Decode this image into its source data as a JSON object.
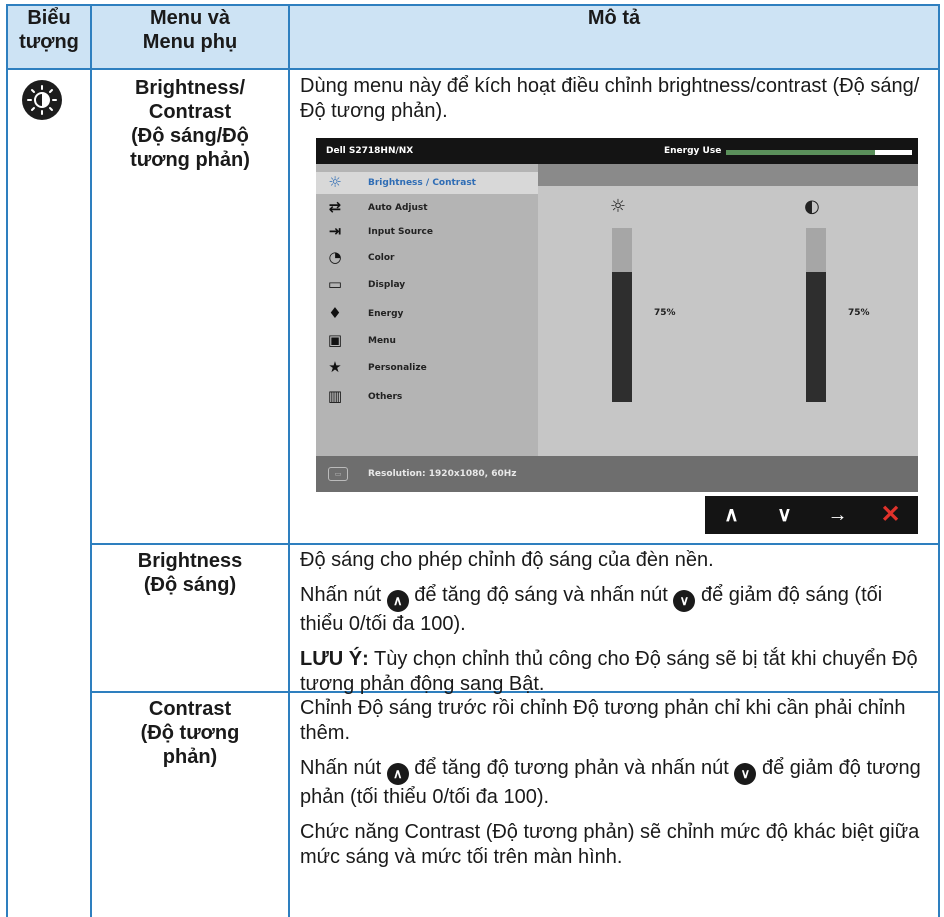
{
  "header": {
    "col1": [
      "Biểu",
      "tượng"
    ],
    "col2": [
      "Menu và",
      "Menu phụ"
    ],
    "col3": "Mô tả"
  },
  "rows": [
    {
      "name": [
        "Brightness/",
        "Contrast",
        "(Độ sáng/Độ",
        "tương phản)"
      ],
      "desc": "Dùng menu này để kích hoạt điều chỉnh brightness/contrast (Độ sáng/Độ tương phản)."
    },
    {
      "name": [
        "Brightness",
        "(Độ sáng)"
      ],
      "p1": "Độ sáng cho phép chỉnh độ sáng của đèn nền.",
      "p2a": "Nhấn nút",
      "p2b": "để tăng độ sáng và nhấn nút",
      "p2c": "để giảm độ sáng (tối thiểu 0/tối đa 100).",
      "note_label": "LƯU Ý:",
      "note_text": "Tùy chọn chỉnh thủ công cho Độ sáng sẽ bị tắt khi chuyển Độ tương phản động sang Bật."
    },
    {
      "name": [
        "Contrast",
        "(Độ tương",
        "phản)"
      ],
      "p1": "Chỉnh Độ sáng trước rồi chỉnh Độ tương phản chỉ khi cần phải chỉnh thêm.",
      "p2a": "Nhấn nút",
      "p2b": "để tăng độ tương phản và nhấn nút",
      "p2c": "để giảm độ tương phản (tối thiểu 0/tối đa 100).",
      "p3": "Chức năng Contrast (Độ tương phản) sẽ chỉnh mức độ khác biệt giữa mức sáng và mức tối trên màn hình."
    }
  ],
  "osd": {
    "model": "Dell S2718HN/NX",
    "energy_label": "Energy Use",
    "energy_level": 0.8,
    "menu": [
      {
        "label": "Brightness / Contrast",
        "icon": "brightness-icon",
        "selected": true
      },
      {
        "label": "Auto Adjust",
        "icon": "auto-adjust-icon"
      },
      {
        "label": "Input Source",
        "icon": "input-source-icon"
      },
      {
        "label": "Color",
        "icon": "color-icon"
      },
      {
        "label": "Display",
        "icon": "display-icon"
      },
      {
        "label": "Energy",
        "icon": "energy-icon"
      },
      {
        "label": "Menu",
        "icon": "menu-icon"
      },
      {
        "label": "Personalize",
        "icon": "star-icon"
      },
      {
        "label": "Others",
        "icon": "others-icon"
      }
    ],
    "brightness_value": "75%",
    "brightness_level": 0.75,
    "contrast_value": "75%",
    "contrast_level": 0.75,
    "status": "Resolution: 1920x1080, 60Hz",
    "nav": [
      "up",
      "down",
      "enter",
      "exit"
    ]
  },
  "colors": {
    "border": "#2e7fbf",
    "header_bg": "#cde3f4",
    "selected_text": "#2f6db5",
    "exit": "#e0322b"
  }
}
